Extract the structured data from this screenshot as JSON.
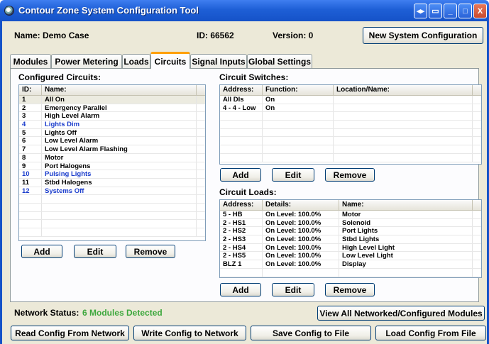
{
  "window": {
    "title": "Contour Zone System Configuration Tool",
    "buttons": [
      "◂▸",
      "▭",
      "_",
      "□",
      "X"
    ]
  },
  "header": {
    "name_label": "Name: Demo Case",
    "id_label": "ID: 66562",
    "version_label": "Version: 0",
    "new_config_button": "New System Configuration"
  },
  "tabs": [
    "Modules",
    "Power Metering",
    "Loads",
    "Circuits",
    "Signal Inputs",
    "Global Settings"
  ],
  "active_tab": "Circuits",
  "configured_circuits": {
    "title": "Configured Circuits:",
    "headers": [
      "ID:",
      "Name:"
    ],
    "rows": [
      {
        "id": "1",
        "name": "All On",
        "blue": false
      },
      {
        "id": "2",
        "name": "Emergency Parallel",
        "blue": false
      },
      {
        "id": "3",
        "name": "High Level Alarm",
        "blue": false
      },
      {
        "id": "4",
        "name": "Lights Dim",
        "blue": true
      },
      {
        "id": "5",
        "name": "Lights Off",
        "blue": false
      },
      {
        "id": "6",
        "name": "Low Level Alarm",
        "blue": false
      },
      {
        "id": "7",
        "name": "Low Level Alarm Flashing",
        "blue": false
      },
      {
        "id": "8",
        "name": "Motor",
        "blue": false
      },
      {
        "id": "9",
        "name": "Port Halogens",
        "blue": false
      },
      {
        "id": "10",
        "name": "Pulsing Lights",
        "blue": true
      },
      {
        "id": "11",
        "name": "Stbd Halogens",
        "blue": false
      },
      {
        "id": "12",
        "name": "Systems Off",
        "blue": true
      }
    ],
    "add": "Add",
    "edit": "Edit",
    "remove": "Remove"
  },
  "circuit_switches": {
    "title": "Circuit Switches:",
    "headers": [
      "Address:",
      "Function:",
      "Location/Name:"
    ],
    "rows": [
      {
        "address": "All DIs",
        "function": "On",
        "location": ""
      },
      {
        "address": "4 - 4 - Low",
        "function": "On",
        "location": ""
      }
    ],
    "add": "Add",
    "edit": "Edit",
    "remove": "Remove"
  },
  "circuit_loads": {
    "title": "Circuit Loads:",
    "headers": [
      "Address:",
      "Details:",
      "Name:"
    ],
    "rows": [
      {
        "address": "5 - HB",
        "details": "On Level: 100.0%",
        "name": "Motor"
      },
      {
        "address": "2 - HS1",
        "details": "On Level: 100.0%",
        "name": "Solenoid"
      },
      {
        "address": "2 - HS2",
        "details": "On Level: 100.0%",
        "name": "Port Lights"
      },
      {
        "address": "2 - HS3",
        "details": "On Level: 100.0%",
        "name": "Stbd Lights"
      },
      {
        "address": "2 - HS4",
        "details": "On Level: 100.0%",
        "name": "High Level Light"
      },
      {
        "address": "2 - HS5",
        "details": "On Level: 100.0%",
        "name": "Low Level Light"
      },
      {
        "address": "BLZ 1",
        "details": "On Level: 100.0%",
        "name": "Display"
      }
    ],
    "add": "Add",
    "edit": "Edit",
    "remove": "Remove"
  },
  "footer": {
    "network_status_label": "Network Status:",
    "network_status_value": "6 Modules Detected",
    "view_all_button": "View All Networked/Configured Modules",
    "read_button": "Read Config From Network",
    "write_button": "Write Config to Network",
    "save_button": "Save Config to File",
    "load_button": "Load Config From File"
  },
  "colors": {
    "title_bar": "#1e5fd6",
    "active_tab_accent": "#ff9f00",
    "blue_text": "#1a3ccc",
    "status_green": "#3ea83e"
  }
}
